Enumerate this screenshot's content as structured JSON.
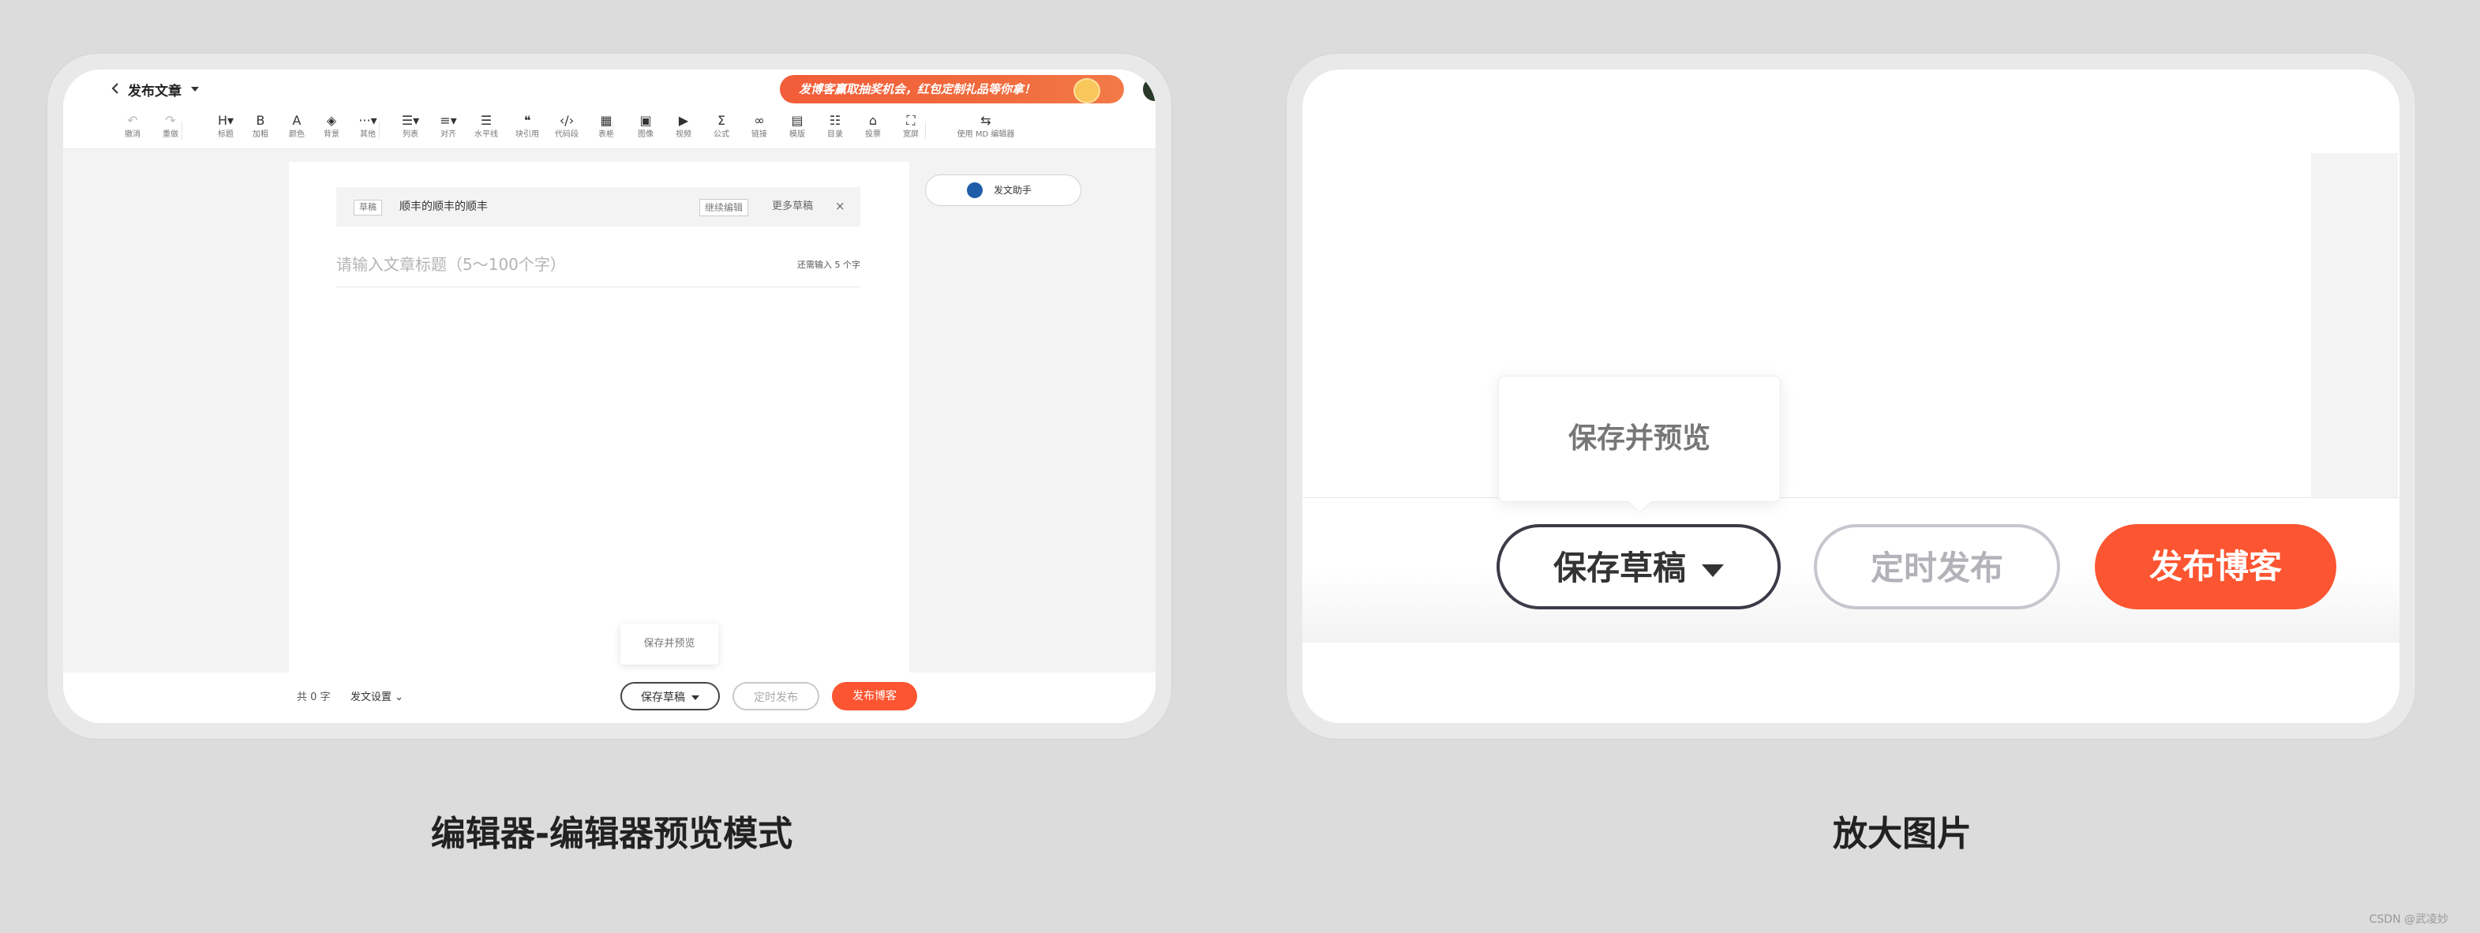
{
  "left_panel": {
    "topbar": {
      "title": "发布文章",
      "banner_text": "发博客赢取抽奖机会，红包定制礼品等你拿！"
    },
    "toolbar": {
      "items": [
        {
          "icon": "undo-icon",
          "glyph": "↶",
          "label": "撤消",
          "dim": true
        },
        {
          "icon": "redo-icon",
          "glyph": "↷",
          "label": "重做",
          "dim": true
        },
        {
          "icon": "heading-icon",
          "glyph": "H▾",
          "label": "标题"
        },
        {
          "icon": "bold-icon",
          "glyph": "B",
          "label": "加粗"
        },
        {
          "icon": "font-color-icon",
          "glyph": "A",
          "label": "颜色"
        },
        {
          "icon": "background-icon",
          "glyph": "◈",
          "label": "背景"
        },
        {
          "icon": "more-icon",
          "glyph": "···▾",
          "label": "其他"
        },
        {
          "icon": "list-icon",
          "glyph": "☰▾",
          "label": "列表"
        },
        {
          "icon": "align-icon",
          "glyph": "≡▾",
          "label": "对齐"
        },
        {
          "icon": "horizontal-rule-icon",
          "glyph": "☰",
          "label": "水平线"
        },
        {
          "icon": "quote-icon",
          "glyph": "❝",
          "label": "块引用"
        },
        {
          "icon": "code-icon",
          "glyph": "‹/›",
          "label": "代码段"
        },
        {
          "icon": "table-icon",
          "glyph": "▦",
          "label": "表格"
        },
        {
          "icon": "image-icon",
          "glyph": "▣",
          "label": "图像"
        },
        {
          "icon": "video-icon",
          "glyph": "▶",
          "label": "视频"
        },
        {
          "icon": "formula-icon",
          "glyph": "Σ",
          "label": "公式"
        },
        {
          "icon": "link-icon",
          "glyph": "∞",
          "label": "链接"
        },
        {
          "icon": "template-icon",
          "glyph": "▤",
          "label": "模版"
        },
        {
          "icon": "toc-icon",
          "glyph": "☷",
          "label": "目录"
        },
        {
          "icon": "vote-icon",
          "glyph": "⌂",
          "label": "投票"
        },
        {
          "icon": "fullscreen-icon",
          "glyph": "⛶",
          "label": "宽屏"
        },
        {
          "icon": "switch-md-icon",
          "glyph": "⇆",
          "label": "使用 MD 编辑器"
        }
      ]
    },
    "draft_bar": {
      "tag": "草稿",
      "name": "顺丰的顺丰的顺丰",
      "continue_label": "继续编辑",
      "more_label": "更多草稿",
      "close_glyph": "×"
    },
    "title_field": {
      "placeholder": "请输入文章标题（5～100个字）",
      "count_hint": "还需输入 5 个字"
    },
    "assistant_label": "发文助手",
    "bottombar": {
      "word_count": "共 0 字",
      "post_settings": "发文设置",
      "save_draft": "保存草稿",
      "schedule": "定时发布",
      "publish": "发布博客",
      "save_preview": "保存并预览"
    }
  },
  "right_panel": {
    "save_preview": "保存并预览",
    "save_draft": "保存草稿",
    "schedule": "定时发布",
    "publish": "发布博客"
  },
  "captions": {
    "left": "编辑器-编辑器预览模式",
    "right": "放大图片"
  },
  "watermark": "CSDN @武凌妙",
  "colors": {
    "accent": "#fc5531",
    "background": "#dcdcdc"
  }
}
